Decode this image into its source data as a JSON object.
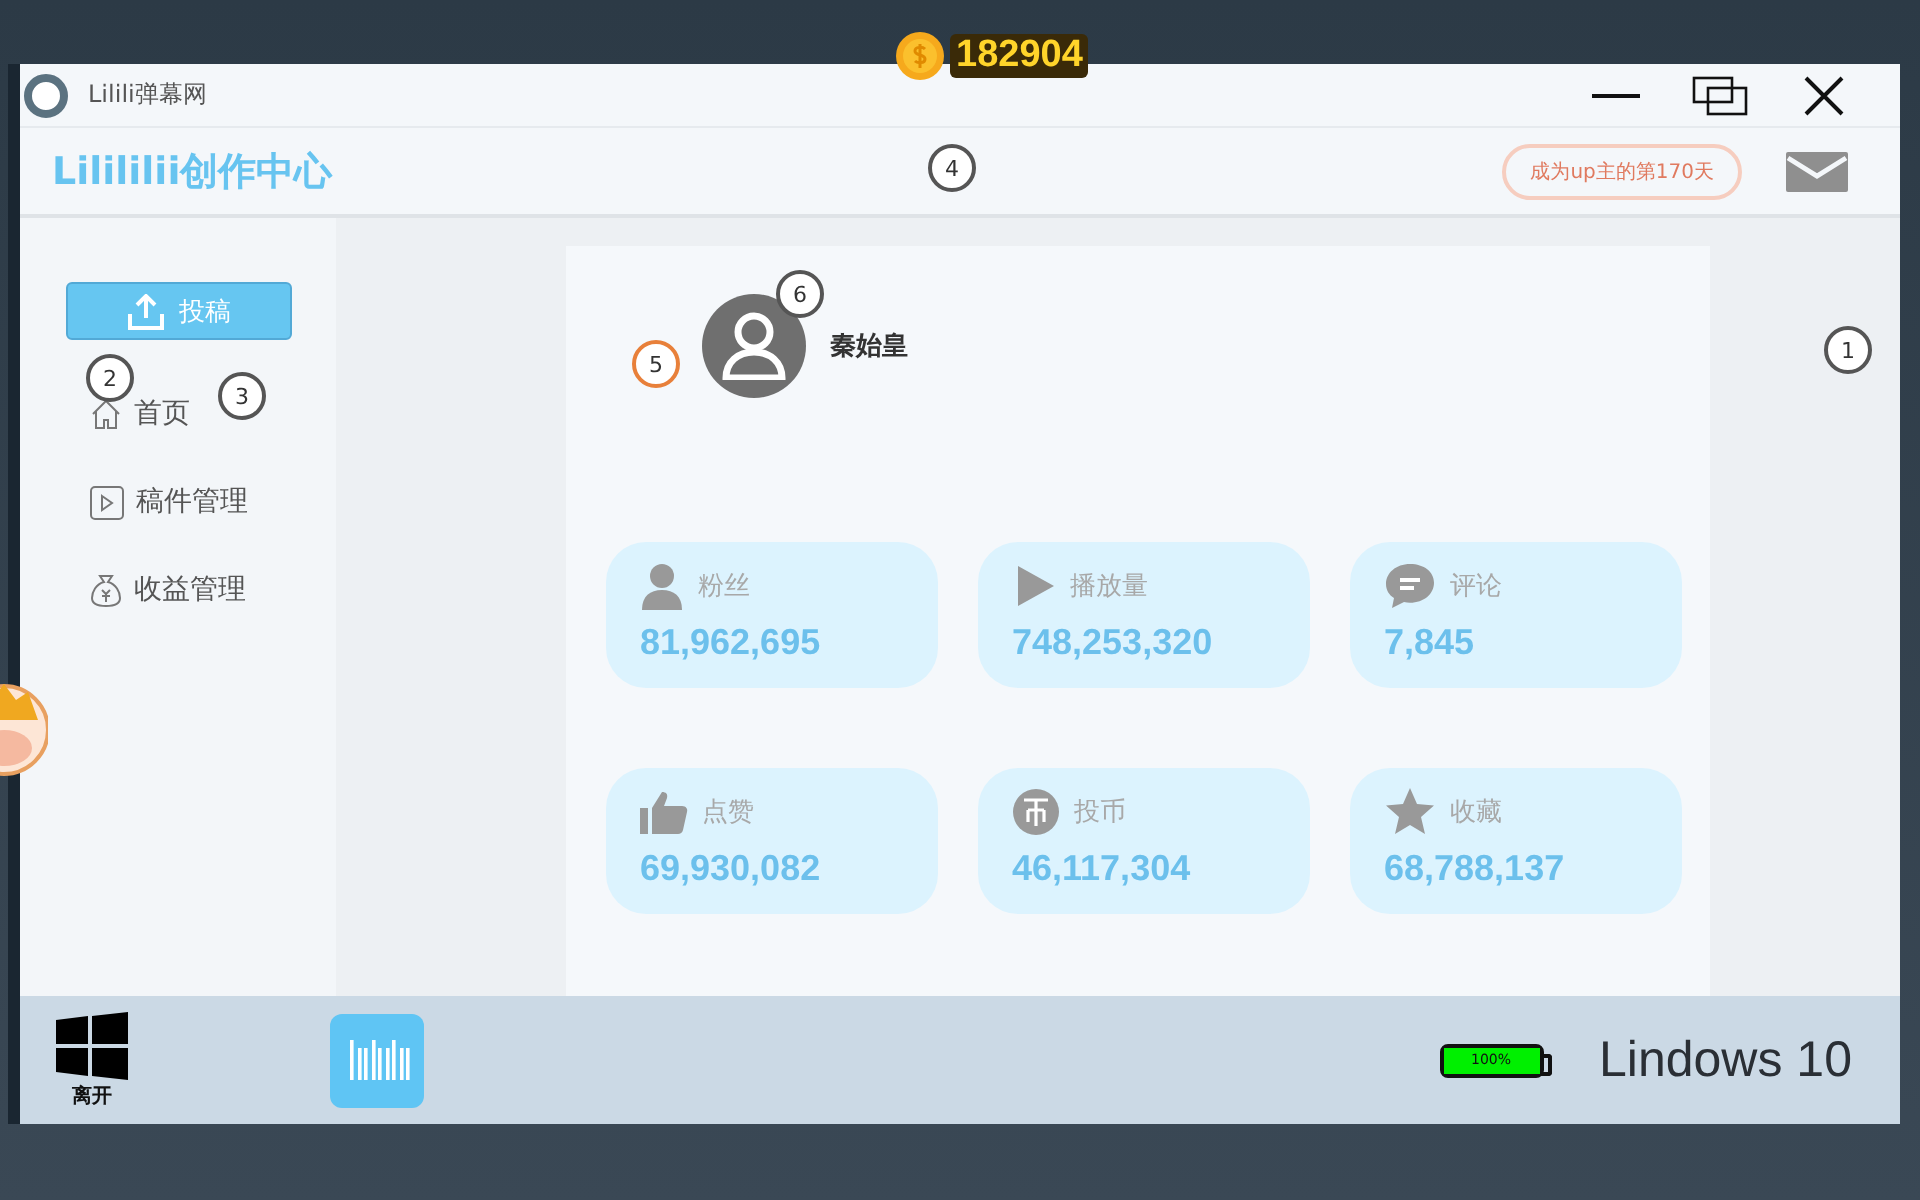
{
  "coins": "182904",
  "window": {
    "title": "Lilili弹幕网"
  },
  "header": {
    "title": "Lilililii创作中心",
    "badge": "成为up主的第170天"
  },
  "sidebar": {
    "upload_button": "投稿",
    "items": [
      {
        "label": "首页",
        "kind": "home"
      },
      {
        "label": "稿件管理",
        "kind": "video"
      },
      {
        "label": "收益管理",
        "kind": "money"
      }
    ]
  },
  "profile": {
    "name": "秦始皇"
  },
  "stats": [
    {
      "label": "粉丝",
      "value": "81,962,695",
      "kind": "fans"
    },
    {
      "label": "播放量",
      "value": "748,253,320",
      "kind": "play"
    },
    {
      "label": "评论",
      "value": "7,845",
      "kind": "comment"
    },
    {
      "label": "点赞",
      "value": "69,930,082",
      "kind": "like"
    },
    {
      "label": "投币",
      "value": "46,117,304",
      "kind": "coin"
    },
    {
      "label": "收藏",
      "value": "68,788,137",
      "kind": "star"
    }
  ],
  "markers": [
    {
      "label": "1",
      "color": "#555555"
    },
    {
      "label": "2",
      "color": "#555555"
    },
    {
      "label": "3",
      "color": "#555555"
    },
    {
      "label": "4",
      "color": "#555555"
    },
    {
      "label": "5",
      "color": "#e8803a"
    },
    {
      "label": "6",
      "color": "#555555"
    }
  ],
  "taskbar": {
    "start_label": "离开",
    "battery": {
      "level": 1,
      "reading": "100%"
    },
    "os_name": "Lindows 10"
  }
}
